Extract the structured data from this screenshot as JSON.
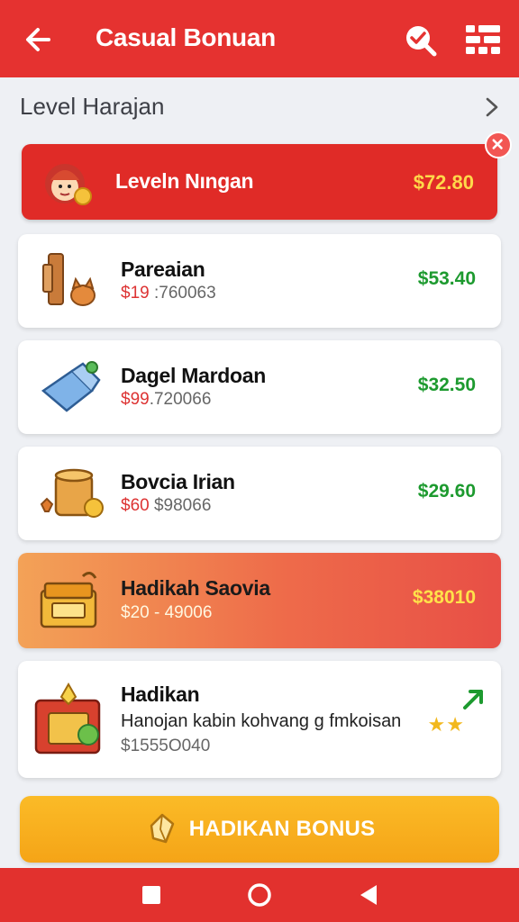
{
  "appbar": {
    "title": "Casual Bonuan",
    "icons": [
      "arrow-left-icon",
      "search-check-icon",
      "grid-menu-icon"
    ]
  },
  "section": {
    "title": "Level Harajan"
  },
  "featured": {
    "name": "Leveln Nıngan",
    "price": "$72.80",
    "icon": "character-avatar-icon"
  },
  "items": [
    {
      "name": "Pareaian",
      "sub_red": "$19",
      "sub_rest": " :760063",
      "price": "$53.40",
      "icon": "wood-and-cat-icon"
    },
    {
      "name": "Dagel Mardoan",
      "sub_red": "$99",
      "sub_rest": ".720066",
      "price": "$32.50",
      "icon": "blue-bag-icon"
    },
    {
      "name": "Bovcia Irian",
      "sub_red": "$60",
      "sub_rest": " $98066",
      "price": "$29.60",
      "icon": "coin-pot-icon"
    }
  ],
  "highlight": {
    "name": "Hadikah Saovia",
    "sub": "$20 - 49006",
    "price": "$38010",
    "icon": "treasure-chest-icon"
  },
  "last": {
    "name": "Hadikan",
    "description": "Hanojan kabin kohvang g fmkoisan",
    "sub": "$1555O040",
    "stars": "★★",
    "icon": "gift-box-icon"
  },
  "bonus": {
    "label": "HADIKAN BONUS",
    "icon": "crystal-icon"
  },
  "colors": {
    "primary": "#e53230",
    "accent": "#f5a417",
    "price_green": "#1d9a2f",
    "price_yellow": "#ffd84a"
  },
  "navbar": {
    "icons": [
      "square-icon",
      "circle-home-icon",
      "triangle-back-icon"
    ]
  }
}
